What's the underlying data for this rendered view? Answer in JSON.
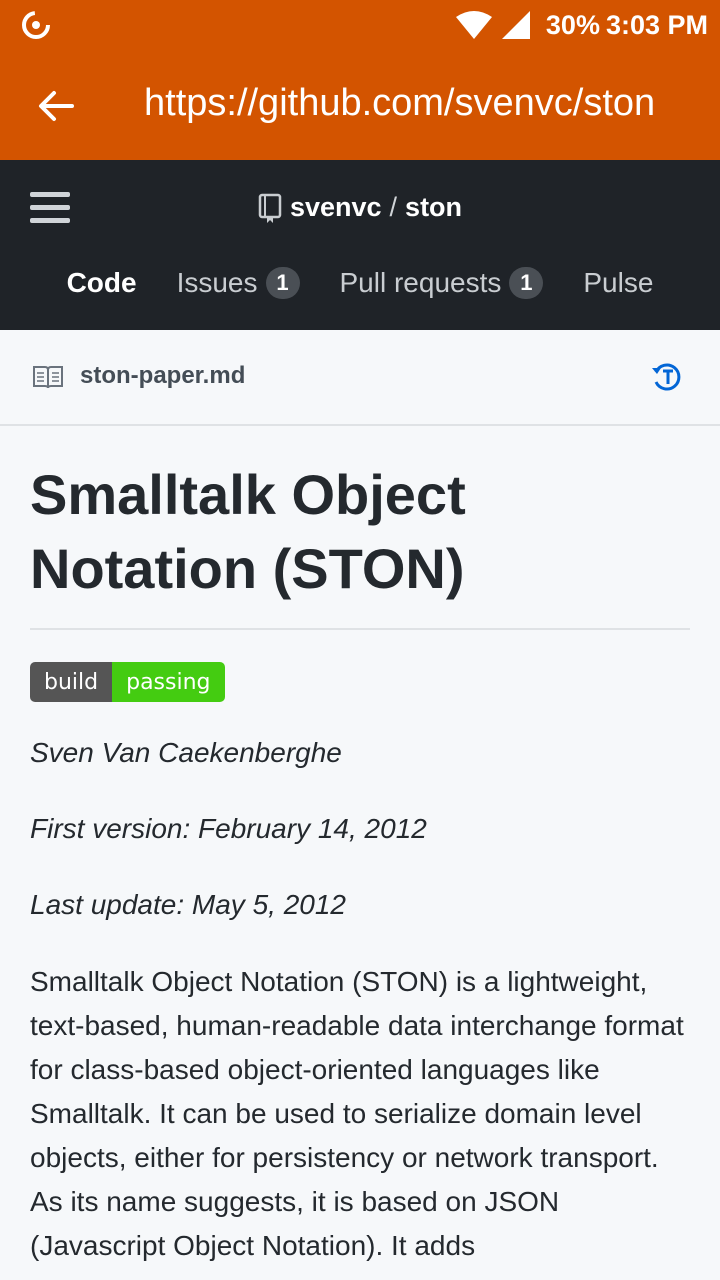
{
  "status_bar": {
    "battery": "30%",
    "time": "3:03 PM"
  },
  "app_bar": {
    "url": "https://github.com/svenvc/ston"
  },
  "repo": {
    "owner": "svenvc",
    "separator": "/",
    "name": "ston"
  },
  "tabs": [
    {
      "label": "Code",
      "count": ""
    },
    {
      "label": "Issues",
      "count": "1"
    },
    {
      "label": "Pull requests",
      "count": "1"
    },
    {
      "label": "Pulse",
      "count": ""
    }
  ],
  "file": {
    "name": "ston-paper.md"
  },
  "document": {
    "title": "Smalltalk Object Notation (STON)",
    "badge": {
      "left": "build",
      "right": "passing"
    },
    "author": "Sven Van Caekenberghe",
    "first_version": "First version: February 14, 2012",
    "last_update": "Last update: May 5, 2012",
    "intro": "Smalltalk Object Notation (STON) is a lightweight, text-based, human-readable data interchange format for class-based object-oriented languages like Smalltalk. It can be used to serialize domain level objects, either for persistency or network transport. As its name suggests, it is based on JSON (Javascript Object Notation). It adds"
  },
  "colors": {
    "app_bar": "#d35400",
    "github_header": "#1f2328",
    "badge_pass": "#44cc11",
    "badge_label": "#555555"
  }
}
